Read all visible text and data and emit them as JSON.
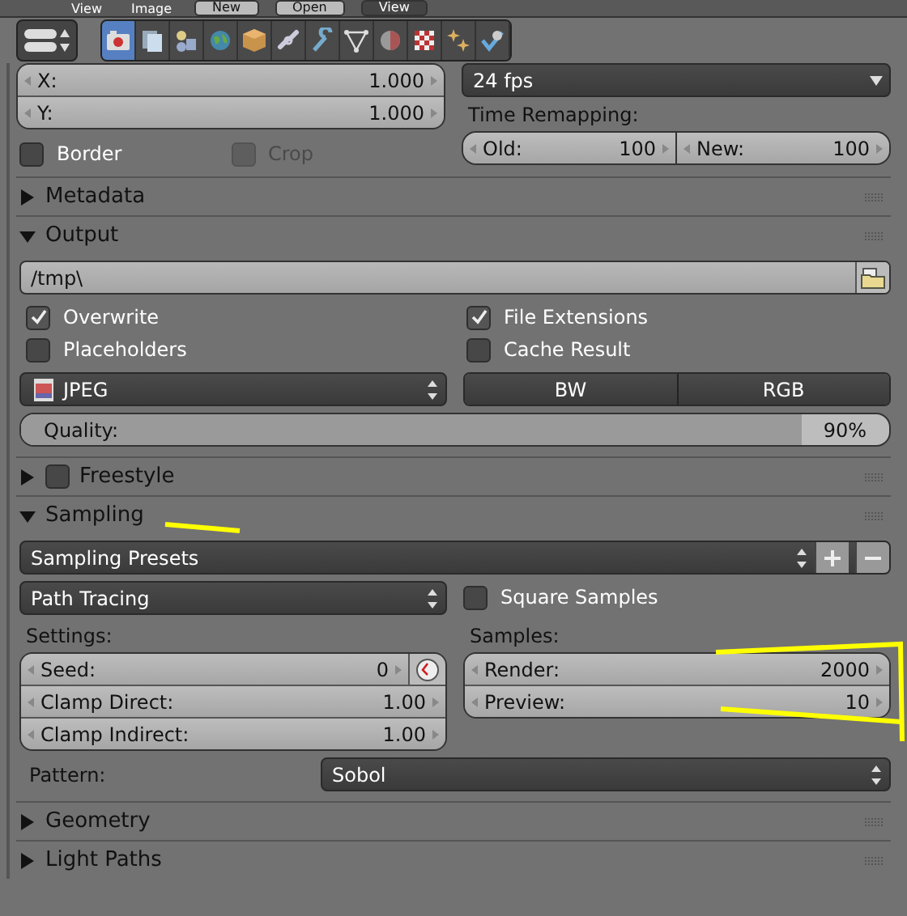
{
  "header": {
    "items": [
      {
        "kind": "menu",
        "label": "View"
      },
      {
        "kind": "menu",
        "label": "Image"
      },
      {
        "kind": "button",
        "label": "New"
      },
      {
        "kind": "button",
        "label": "Open"
      },
      {
        "kind": "dropdown",
        "label": "View"
      }
    ]
  },
  "context_tabs": [
    {
      "kind": "camera",
      "selected": true
    },
    {
      "kind": "layers",
      "selected": false
    },
    {
      "kind": "scene",
      "selected": false
    },
    {
      "kind": "world",
      "selected": false
    },
    {
      "kind": "cube",
      "selected": false
    },
    {
      "kind": "chain",
      "selected": false
    },
    {
      "kind": "wrench",
      "selected": false
    },
    {
      "kind": "triangle",
      "selected": false
    },
    {
      "kind": "sphere",
      "selected": false
    },
    {
      "kind": "checker",
      "selected": false
    },
    {
      "kind": "sparkle",
      "selected": false
    },
    {
      "kind": "physics",
      "selected": false
    }
  ],
  "dimensions": {
    "fields": [
      {
        "label": "X:",
        "value": "1.000"
      },
      {
        "label": "Y:",
        "value": "1.000"
      }
    ],
    "frame_rate": "24 fps",
    "time_remapping_label": "Time Remapping:",
    "time_remapping": [
      {
        "label": "Old:",
        "value": "100"
      },
      {
        "label": "New:",
        "value": "100"
      }
    ],
    "checkboxes": [
      {
        "label": "Border",
        "checked": false,
        "disabled": false
      },
      {
        "label": "Crop",
        "checked": false,
        "disabled": true
      }
    ]
  },
  "panels": [
    {
      "title": "Metadata",
      "expanded": false
    },
    {
      "kind": "output",
      "title": "Output",
      "expanded": true,
      "path": "/tmp\\",
      "options": [
        {
          "label": "Overwrite",
          "checked": true
        },
        {
          "label": "File Extensions",
          "checked": true
        },
        {
          "label": "Placeholders",
          "checked": false
        },
        {
          "label": "Cache Result",
          "checked": false
        }
      ],
      "format": "JPEG",
      "color_modes": [
        {
          "label": "BW",
          "selected": false
        },
        {
          "label": "RGB",
          "selected": false
        }
      ],
      "quality": {
        "label": "Quality:",
        "reading": "90%",
        "level": 0.9
      }
    },
    {
      "title": "Freestyle",
      "expanded": false,
      "checkbox": {
        "checked": false
      }
    },
    {
      "kind": "sampling",
      "title": "Sampling",
      "expanded": true,
      "presets": "Sampling Presets",
      "integrator": "Path Tracing",
      "square_samples": {
        "label": "Square Samples",
        "checked": false
      },
      "settings_label": "Settings:",
      "settings": [
        {
          "label": "Seed:",
          "value": "0"
        },
        {
          "label": "Clamp Direct:",
          "value": "1.00"
        },
        {
          "label": "Clamp Indirect:",
          "value": "1.00"
        }
      ],
      "samples_label": "Samples:",
      "samples": [
        {
          "label": "Render:",
          "value": "2000"
        },
        {
          "label": "Preview:",
          "value": "10"
        }
      ],
      "pattern_label": "Pattern:",
      "pattern": "Sobol"
    },
    {
      "title": "Geometry",
      "expanded": false
    },
    {
      "title": "Light Paths",
      "expanded": false
    }
  ]
}
